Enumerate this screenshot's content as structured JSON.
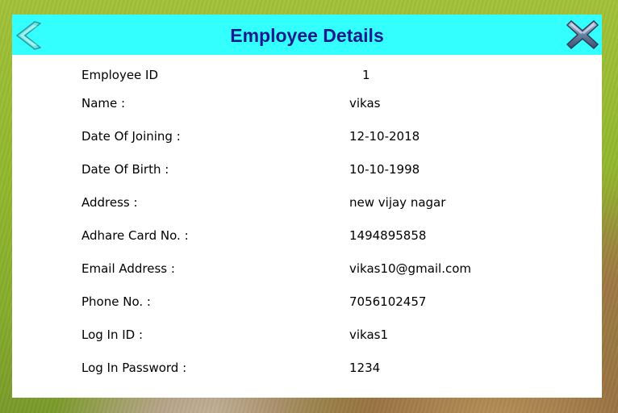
{
  "window": {
    "title": "Employee Details",
    "back_icon": "back-chevron-icon",
    "close_icon": "close-x-icon"
  },
  "colors": {
    "title_bar_bg": "#33ffff",
    "title_text": "#1a1a8f",
    "dialog_bg": "#ffffff"
  },
  "details": {
    "employee_id": {
      "label": "Employee ID",
      "value": "1"
    },
    "name": {
      "label": "Name :",
      "value": "vikas"
    },
    "date_of_joining": {
      "label": "Date Of Joining :",
      "value": "12-10-2018"
    },
    "date_of_birth": {
      "label": "Date Of Birth :",
      "value": "10-10-1998"
    },
    "address": {
      "label": "Address :",
      "value": "new vijay nagar"
    },
    "adhare_card": {
      "label": "Adhare Card No. :",
      "value": "1494895858"
    },
    "email": {
      "label": "Email Address :",
      "value": "vikas10@gmail.com"
    },
    "phone": {
      "label": "Phone No. :",
      "value": "7056102457"
    },
    "login_id": {
      "label": "Log In ID :",
      "value": "vikas1"
    },
    "login_password": {
      "label": "Log In Password :",
      "value": "1234"
    }
  }
}
